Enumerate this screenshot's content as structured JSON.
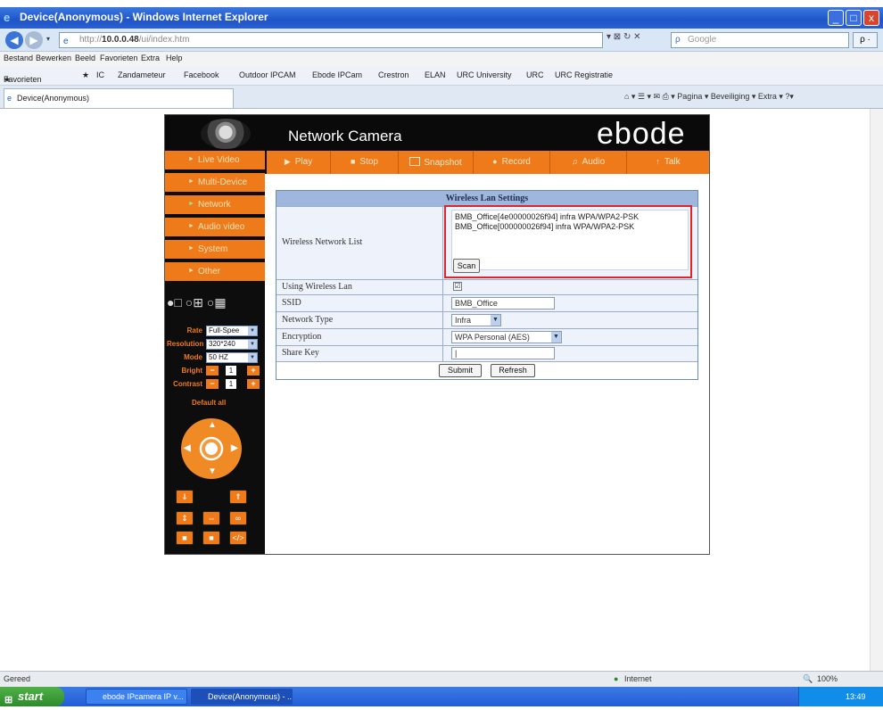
{
  "window": {
    "title": "Device(Anonymous) - Windows Internet Explorer",
    "minimize": "_",
    "maximize": "□",
    "close": "x"
  },
  "address_bar": {
    "url_prefix": "http://",
    "url_host": "10.0.0.48",
    "url_path": "/ui/index.htm",
    "tools": "▾ ⊠ ↻ ✕",
    "search_placeholder": "Google",
    "search_go": "ρ ·"
  },
  "menu": {
    "items": [
      "Bestand",
      "Bewerken",
      "Beeld",
      "Favorieten",
      "Extra",
      "Help"
    ]
  },
  "favorites": {
    "label": "Favorieten",
    "items": [
      "IC",
      "Zandameteur",
      "Facebook",
      "Outdoor IPCAM",
      "Ebode IPCam",
      "Crestron",
      "ELAN",
      "URC University",
      "URC",
      "URC Registratie"
    ]
  },
  "tab": {
    "label": "Device(Anonymous)"
  },
  "command_bar": {
    "text": "⌂ ▾  ☰ ▾  ✉  ⎙ ▾  Pagina ▾  Beveiliging ▾  Extra ▾  ?▾"
  },
  "camera": {
    "title": "Network Camera",
    "brand": "ebode",
    "sidebar": [
      "Live Video",
      "Multi-Device",
      "Network",
      "Audio video",
      "System",
      "Other"
    ],
    "toolbar": [
      {
        "icon": "▶",
        "label": "Play"
      },
      {
        "icon": "■",
        "label": "Stop"
      },
      {
        "icon": "",
        "label": "Snapshot"
      },
      {
        "icon": "●",
        "label": "Record"
      },
      {
        "icon": "♫",
        "label": "Audio"
      },
      {
        "icon": "↑",
        "label": "Talk"
      }
    ],
    "view_icons": "●□ ○⊞ ○▦",
    "controls": {
      "rate_label": "Rate",
      "rate_value": "Full-Spee",
      "resolution_label": "Resolution",
      "resolution_value": "320*240",
      "mode_label": "Mode",
      "mode_value": "50 HZ",
      "bright_label": "Bright",
      "bright_value": "1",
      "contrast_label": "Contrast",
      "contrast_value": "1",
      "default_all": "Default all"
    },
    "ptz_buttons": [
      "⇓",
      "⇑",
      "⇕",
      "⇔",
      "∞",
      "■",
      "■",
      "</>"
    ]
  },
  "wireless": {
    "heading": "Wireless Lan Settings",
    "network_list_label": "Wireless Network List",
    "networks": [
      "BMB_Office[4e00000026f94] infra WPA/WPA2-PSK",
      "BMB_Office[000000026f94] infra WPA/WPA2-PSK"
    ],
    "scan_button": "Scan",
    "using_wireless_label": "Using Wireless Lan",
    "using_wireless_checked": "☑",
    "ssid_label": "SSID",
    "ssid_value": "BMB_Office",
    "network_type_label": "Network Type",
    "network_type_value": "Infra",
    "encryption_label": "Encryption",
    "encryption_value": "WPA Personal (AES)",
    "share_key_label": "Share Key",
    "share_key_value": "|",
    "submit_button": "Submit",
    "refresh_button": "Refresh"
  },
  "status_bar": {
    "left": "Gereed",
    "zone": "Internet",
    "zoom": "100%"
  },
  "taskbar": {
    "start": "start",
    "items": [
      "ebode IPcamera IP v...",
      "Device(Anonymous) - ..."
    ],
    "clock": "13:49"
  },
  "colors": {
    "accent_orange": "#ef7a1a",
    "highlight_red": "#e2232a",
    "panel_header": "#9fb7dd",
    "xp_blue": "#245dd6"
  }
}
